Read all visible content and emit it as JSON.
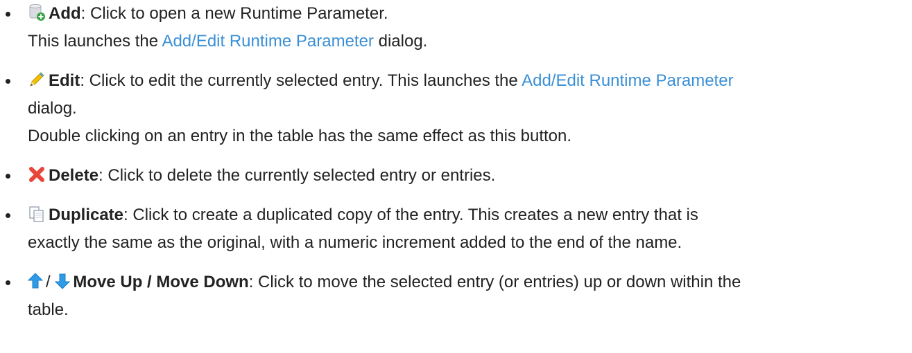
{
  "items": [
    {
      "icon": "add-database-icon",
      "term": "Add",
      "text": ": Click to open a new Runtime Parameter.",
      "line2_pre": "This launches the ",
      "line2_link": "Add/Edit Runtime Parameter",
      "line2_post": " dialog."
    },
    {
      "icon": "pencil-icon",
      "term": "Edit",
      "text": ": Click to edit the currently selected entry. This launches the ",
      "link": "Add/Edit Runtime Parameter",
      "line2": "dialog.",
      "line3": "Double clicking on an entry in the table has the same effect as this button."
    },
    {
      "icon": "red-x-icon",
      "term": "Delete",
      "text": ": Click to delete the currently selected entry or entries."
    },
    {
      "icon": "duplicate-pages-icon",
      "term": "Duplicate",
      "text": ": Click to create a duplicated copy of the entry. This creates a new entry that is",
      "line2": "exactly the same as the original, with a numeric increment added to the end of the name."
    },
    {
      "icons": [
        "up-arrow-icon",
        "down-arrow-icon"
      ],
      "separator": "/",
      "term": "Move Up / Move Down",
      "text": ": Click to move the selected entry (or entries) up or down within the",
      "line2": "table."
    }
  ],
  "colors": {
    "text": "#222222",
    "link": "#3a8fd6",
    "delete_icon": "#e8463a",
    "arrow_icon": "#2e9be8"
  }
}
